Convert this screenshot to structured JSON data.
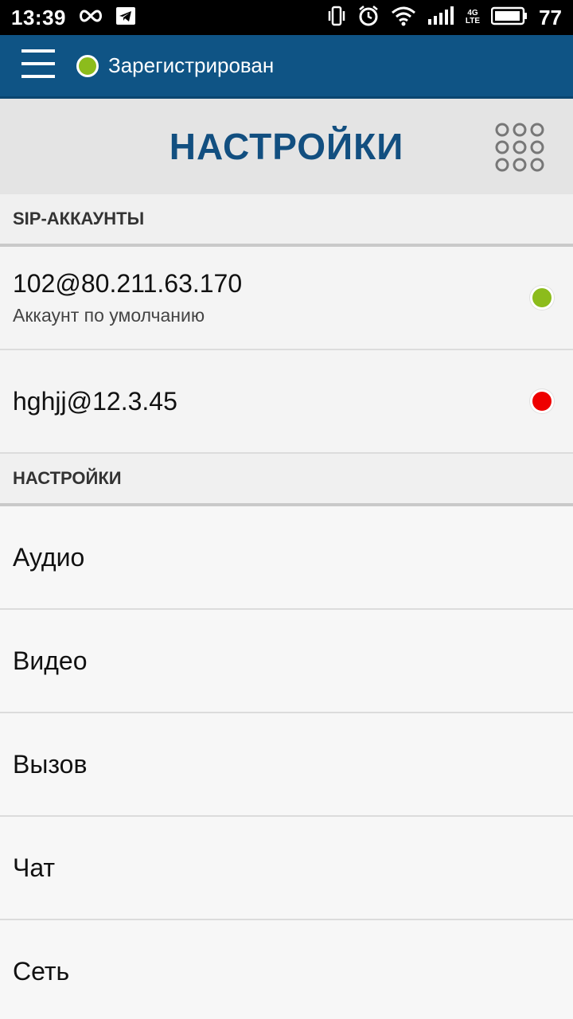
{
  "status_bar": {
    "time": "13:39",
    "network_type_top": "4G",
    "network_type_bottom": "LTE",
    "battery": "77",
    "icons": [
      "infinity-icon",
      "telegram-icon",
      "vibrate-icon",
      "alarm-icon",
      "wifi-icon",
      "signal-icon",
      "battery-icon"
    ]
  },
  "app_bar": {
    "registration_status": "Зарегистрирован",
    "status_color": "#8cbc1c",
    "background": "#0f5485"
  },
  "title_bar": {
    "title": "НАСТРОЙКИ"
  },
  "sections": {
    "accounts_header": "SIP-АККАУНТЫ",
    "settings_header": "НАСТРОЙКИ"
  },
  "accounts": [
    {
      "name": "102@80.211.63.170",
      "subtitle": "Аккаунт по умолчанию",
      "status_color": "#8cbc1c"
    },
    {
      "name": "hghjj@12.3.45",
      "subtitle": "",
      "status_color": "#ee0000"
    }
  ],
  "settings": [
    {
      "label": "Аудио"
    },
    {
      "label": "Видео"
    },
    {
      "label": "Вызов"
    },
    {
      "label": "Чат"
    },
    {
      "label": "Сеть"
    }
  ]
}
